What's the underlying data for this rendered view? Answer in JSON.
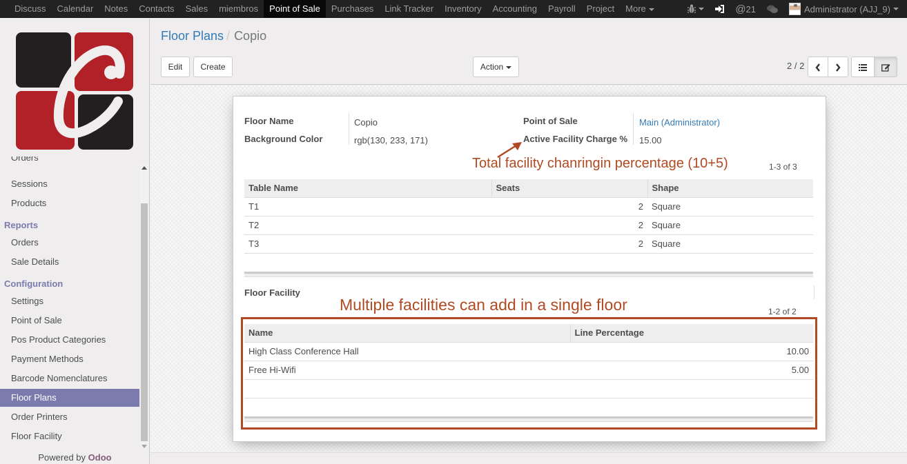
{
  "topbar": {
    "menu": [
      {
        "label": "Discuss",
        "active": false
      },
      {
        "label": "Calendar",
        "active": false
      },
      {
        "label": "Notes",
        "active": false
      },
      {
        "label": "Contacts",
        "active": false
      },
      {
        "label": "Sales",
        "active": false
      },
      {
        "label": "miembros",
        "active": false
      },
      {
        "label": "Point of Sale",
        "active": true
      },
      {
        "label": "Purchases",
        "active": false
      },
      {
        "label": "Link Tracker",
        "active": false
      },
      {
        "label": "Inventory",
        "active": false
      },
      {
        "label": "Accounting",
        "active": false
      },
      {
        "label": "Payroll",
        "active": false
      },
      {
        "label": "Project",
        "active": false
      },
      {
        "label": "More",
        "active": false
      }
    ],
    "debug_icon": "bug-icon",
    "login_icon": "sign-in-icon",
    "mentions_icon": "at-icon",
    "mentions_count": "21",
    "chat_icon": "comments-icon",
    "user_name": "Administrator (AJJ_9)"
  },
  "sidebar": {
    "partial_item": "Orders",
    "items_top": [
      "Sessions",
      "Products"
    ],
    "reports_header": "Reports",
    "reports_items": [
      "Orders",
      "Sale Details"
    ],
    "config_header": "Configuration",
    "config_items": [
      "Settings",
      "Point of Sale",
      "Pos Product Categories",
      "Payment Methods",
      "Barcode Nomenclatures",
      "Floor Plans",
      "Order Printers",
      "Floor Facility"
    ],
    "active_item": "Floor Plans",
    "powered_prefix": "Powered by ",
    "powered_brand": "Odoo",
    "accent": "#7c7bad"
  },
  "control_panel": {
    "breadcrumb_parent": "Floor Plans",
    "breadcrumb_sep": "/",
    "breadcrumb_current": "Copio",
    "edit_label": "Edit",
    "create_label": "Create",
    "action_label": "Action",
    "pager": "2 / 2"
  },
  "form": {
    "floor_name_label": "Floor Name",
    "floor_name": "Copio",
    "bg_color_label": "Background Color",
    "bg_color": "rgb(130, 233, 171)",
    "pos_label": "Point of Sale",
    "pos_value": "Main (Administrator)",
    "charge_label": "Active Facility Charge %",
    "charge_value": "15.00",
    "tables": {
      "count": "1-3 of 3",
      "headers": [
        "Table Name",
        "Seats",
        "Shape"
      ],
      "rows": [
        {
          "name": "T1",
          "seats": "2",
          "shape": "Square"
        },
        {
          "name": "T2",
          "seats": "2",
          "shape": "Square"
        },
        {
          "name": "T3",
          "seats": "2",
          "shape": "Square"
        }
      ]
    },
    "facility_label": "Floor Facility",
    "facilities": {
      "count": "1-2 of 2",
      "headers": [
        "Name",
        "Line Percentage"
      ],
      "rows": [
        {
          "name": "High Class Conference Hall",
          "pct": "10.00"
        },
        {
          "name": "Free Hi-Wifi",
          "pct": "5.00"
        }
      ]
    }
  },
  "annotations": {
    "charge_note": "Total facility chanringin percentage (10+5)",
    "facility_note": "Multiple facilities can add in a single floor",
    "color": "#b04a22"
  }
}
